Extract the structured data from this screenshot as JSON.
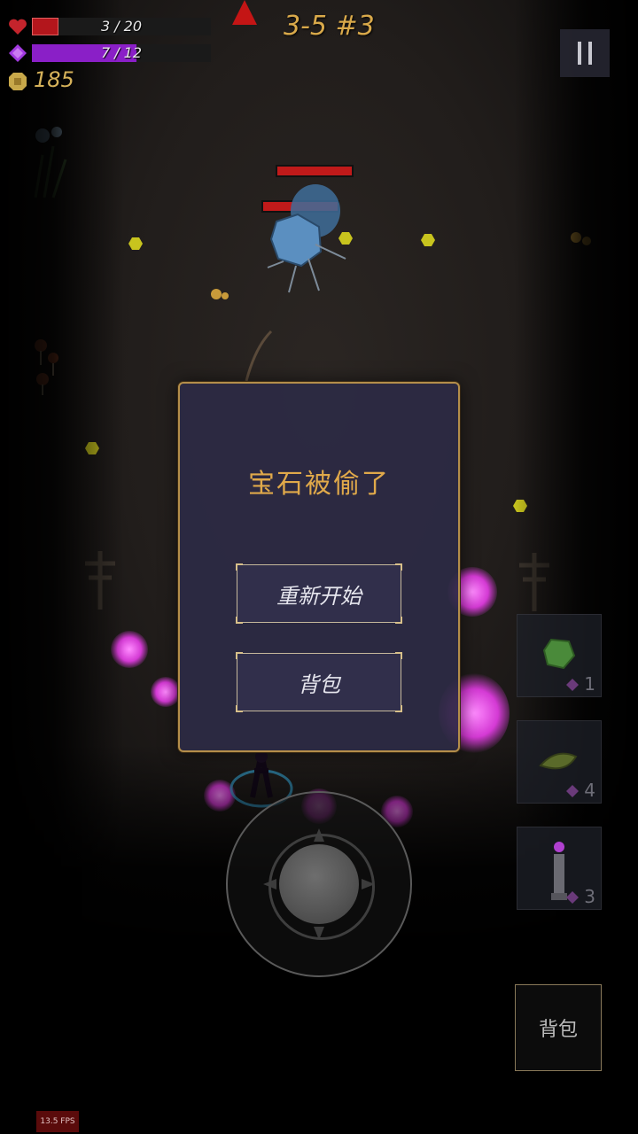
{
  "hud": {
    "health_text": "3 / 20",
    "health_fraction": 0.15,
    "mana_text": "7 / 12",
    "mana_fraction": 0.5833,
    "gold": "185",
    "stage": "3-5 #3"
  },
  "modal": {
    "title": "宝石被偷了",
    "restart_label": "重新开始",
    "backpack_label": "背包"
  },
  "slots": [
    {
      "count": "1",
      "icon": "green-gem-icon"
    },
    {
      "count": "4",
      "icon": "leaf-gem-icon"
    },
    {
      "count": "3",
      "icon": "pillar-icon"
    }
  ],
  "bag_button_label": "背包",
  "fps": "13.5 FPS",
  "colors": {
    "health": "#b3161c",
    "mana": "#8a1fc7",
    "gold": "#d6b25a",
    "accent": "#e0a94a",
    "modal_border": "#b48e4a"
  },
  "icons": [
    "heart-icon",
    "mana-crystal-icon",
    "gold-coin-icon",
    "pause-icon",
    "joystick-icon"
  ]
}
